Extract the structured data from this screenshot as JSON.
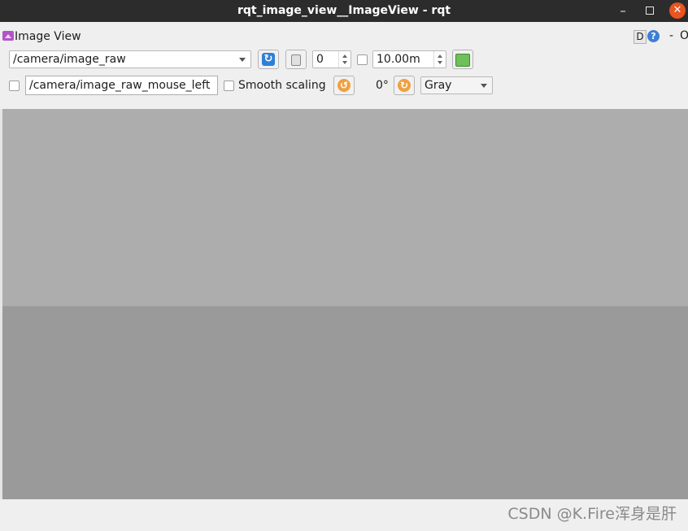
{
  "window": {
    "title": "rqt_image_view__ImageView - rqt",
    "minimize_glyph": "–",
    "close_glyph": "✕"
  },
  "plugin": {
    "title": "Image View",
    "d_label": "D",
    "help_label": "?",
    "dash_label": "-",
    "close_label": "O"
  },
  "toolbar": {
    "topic": "/camera/image_raw",
    "refresh_glyph": "↻",
    "frame_value": "0",
    "timeout_value": "10.00m",
    "mouse_topic": "/camera/image_raw_mouse_left",
    "smooth_scaling_label": "Smooth scaling",
    "rotate_ccw_glyph": "↺",
    "rotation_label": "0°",
    "rotate_cw_glyph": "↻",
    "colormap": "Gray"
  },
  "icons": {
    "refresh": "refresh-icon",
    "pause": "pause-icon",
    "save": "save-icon",
    "rotate_ccw": "rotate-left-icon",
    "rotate_cw": "rotate-right-icon",
    "plugin": "image-view-icon",
    "help": "help-icon"
  },
  "colors": {
    "titlebar": "#2c2c2c",
    "close_button": "#e95420",
    "image_top": "#adadad",
    "image_bottom": "#9a9a9a"
  },
  "watermark": "CSDN @K.Fire浑身是肝"
}
